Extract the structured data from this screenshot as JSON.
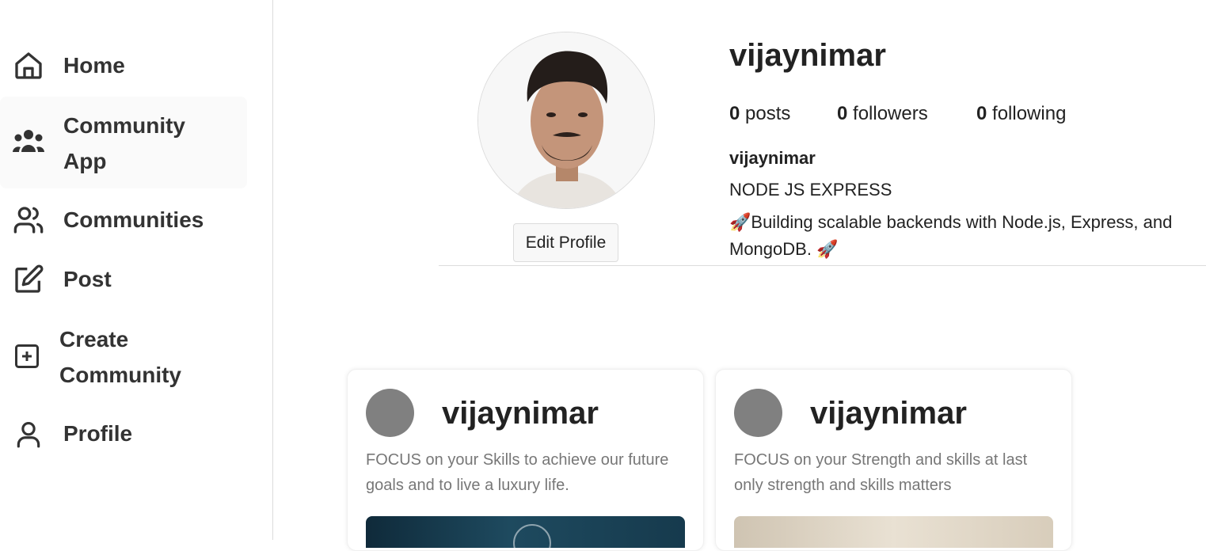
{
  "sidebar": {
    "items": [
      {
        "label": "Home",
        "icon": "home-icon"
      },
      {
        "label": "Community App",
        "icon": "users-group-icon"
      },
      {
        "label": "Communities",
        "icon": "users-icon"
      },
      {
        "label": "Post",
        "icon": "edit-icon"
      },
      {
        "label": "Create Community",
        "icon": "plus-square-icon"
      },
      {
        "label": "Profile",
        "icon": "user-icon"
      }
    ]
  },
  "profile": {
    "username": "vijaynimar",
    "edit_label": "Edit Profile",
    "stats": {
      "posts_count": "0",
      "posts_label": "posts",
      "followers_count": "0",
      "followers_label": "followers",
      "following_count": "0",
      "following_label": "following"
    },
    "bio": {
      "name": "vijaynimar",
      "title": "NODE JS EXPRESS",
      "text": "🚀Building scalable backends with Node.js, Express, and MongoDB. 🚀"
    }
  },
  "posts": [
    {
      "username": "vijaynimar",
      "text": "FOCUS on your Skills to achieve our future goals and to live a luxury life."
    },
    {
      "username": "vijaynimar",
      "text": "FOCUS on your Strength and skills at last only strength and skills matters"
    }
  ]
}
